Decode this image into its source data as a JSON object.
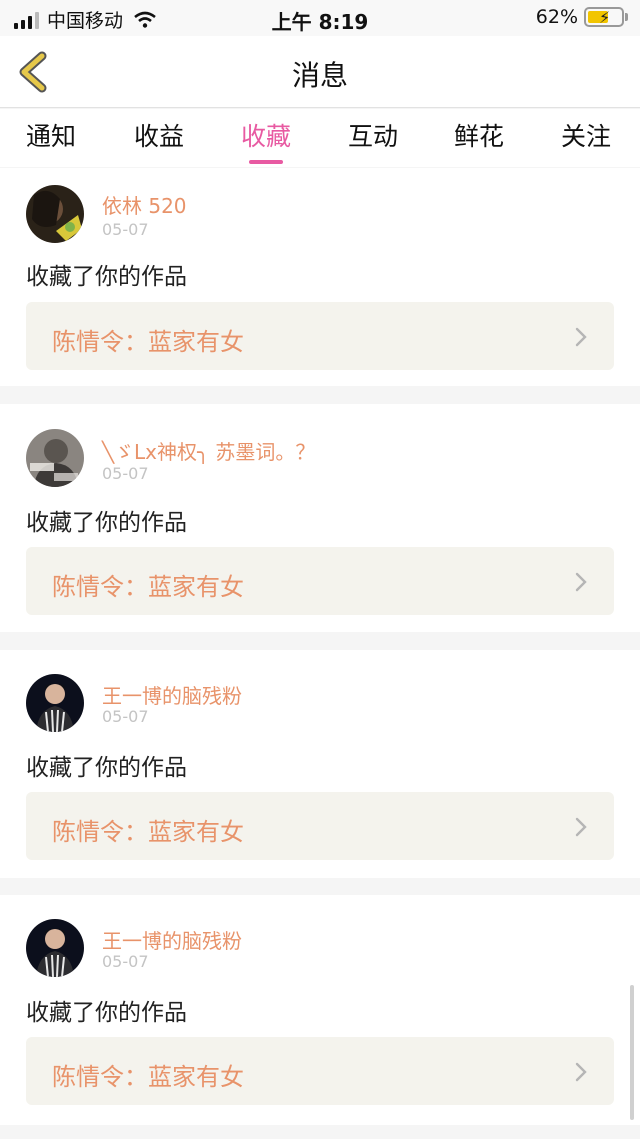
{
  "status_bar": {
    "carrier": "中国移动",
    "time": "上午 8:19",
    "battery_percent": "62%",
    "battery_level": 0.62
  },
  "nav": {
    "title": "消息",
    "back_icon": "chevron-left-icon"
  },
  "tabs": [
    {
      "label": "通知",
      "active": false
    },
    {
      "label": "收益",
      "active": false
    },
    {
      "label": "收藏",
      "active": true
    },
    {
      "label": "互动",
      "active": false
    },
    {
      "label": "鲜花",
      "active": false
    },
    {
      "label": "关注",
      "active": false
    }
  ],
  "messages": [
    {
      "username": "依林 520",
      "date": "05-07",
      "action": "收藏了你的作品",
      "work_title": "陈情令：蓝家有女"
    },
    {
      "username": "╲ゞLx神权╮ 苏墨词。？",
      "date": "05-07",
      "action": "收藏了你的作品",
      "work_title": "陈情令：蓝家有女"
    },
    {
      "username": "王一博的脑残粉",
      "date": "05-07",
      "action": "收藏了你的作品",
      "work_title": "陈情令：蓝家有女"
    },
    {
      "username": "王一博的脑残粉",
      "date": "05-07",
      "action": "收藏了你的作品",
      "work_title": "陈情令：蓝家有女"
    }
  ],
  "colors": {
    "accent": "#e85aa2",
    "username": "#e8936a",
    "work_box_bg": "#f4f3ed"
  }
}
